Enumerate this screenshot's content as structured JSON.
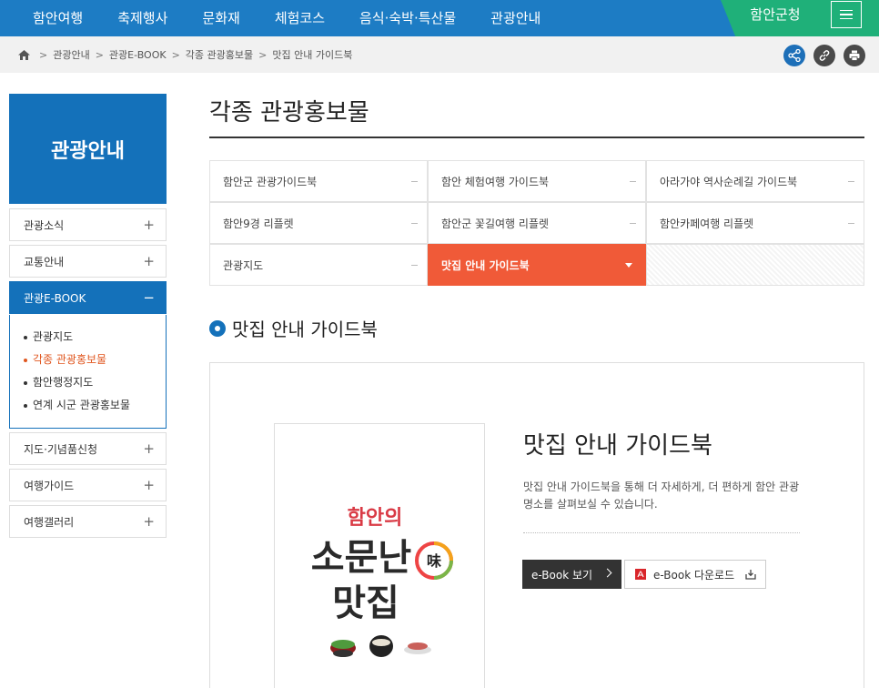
{
  "nav": {
    "items": [
      "함안여행",
      "축제행사",
      "문화재",
      "체험코스",
      "음식·숙박·특산물",
      "관광안내"
    ],
    "gov": "함안군청"
  },
  "breadcrumb": [
    "관광안내",
    "관광E-BOOK",
    "각종 관광홍보물",
    "맛집 안내 가이드북"
  ],
  "sidebar": {
    "title": "관광안내",
    "items": [
      {
        "label": "관광소식",
        "sign": "+"
      },
      {
        "label": "교통안내",
        "sign": "+"
      },
      {
        "label": "관광E-BOOK",
        "sign": "−"
      },
      {
        "label": "지도·기념품신청",
        "sign": "+"
      },
      {
        "label": "여행가이드",
        "sign": "+"
      },
      {
        "label": "여행갤러리",
        "sign": "+"
      }
    ],
    "sub": [
      "관광지도",
      "각종 관광홍보물",
      "함안행정지도",
      "연계 시군 관광홍보물"
    ]
  },
  "main": {
    "title": "각종 관광홍보물",
    "grid": [
      "함안군 관광가이드북",
      "함안 체험여행 가이드북",
      "아라가야 역사순례길 가이드북",
      "함안9경 리플렛",
      "함안군 꽃길여행 리플렛",
      "함안카페여행 리플렛",
      "관광지도",
      "맛집 안내 가이드북"
    ],
    "section_title": "맛집 안내 가이드북",
    "book": {
      "title": "맛집 안내 가이드북",
      "desc": "맛집 안내 가이드북을 통해 더 자세하게, 더 편하게 함안 관광명소를 살펴보실 수 있습니다.",
      "view": "e-Book 보기",
      "download": "e-Book 다운로드"
    },
    "cover": {
      "line1": "함안의",
      "line2": "소문난",
      "line3": "맛집",
      "badge": "味"
    }
  },
  "colors": {
    "nav": "#1d7cc4",
    "gov": "#1fb079",
    "accent": "#f05a38",
    "sidebar": "#1471ba"
  }
}
